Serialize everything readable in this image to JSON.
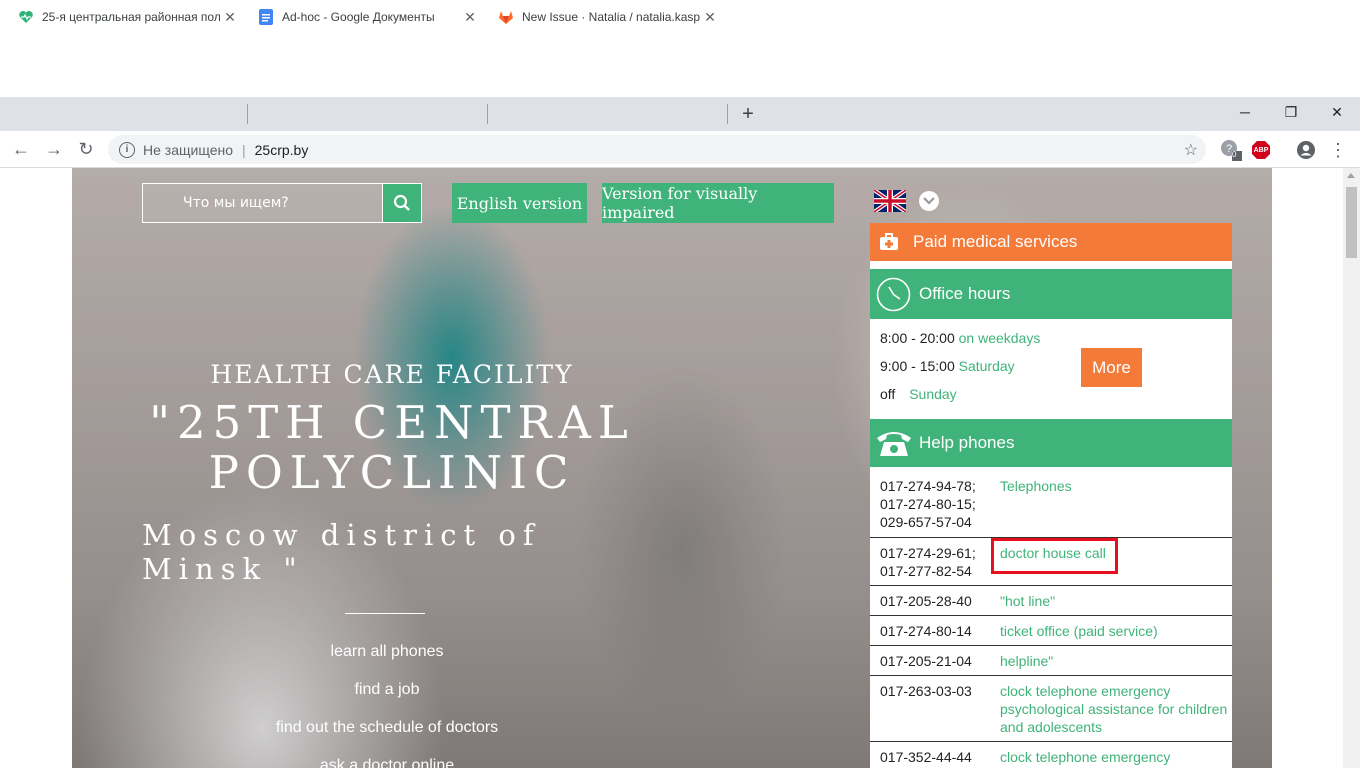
{
  "browser": {
    "tabs": [
      {
        "title": "25-я центральная районная пол",
        "close": "✕"
      },
      {
        "title": "Ad-hoc - Google Документы",
        "close": "✕"
      },
      {
        "title": "New Issue · Natalia / natalia.kasp",
        "close": "✕"
      }
    ],
    "new_tab": "+",
    "window": {
      "minimize": "─",
      "maximize": "❐",
      "close": "✕"
    },
    "nav": {
      "back": "←",
      "forward": "→",
      "reload": "↻"
    },
    "omnibox": {
      "security": "Не защищено",
      "url": "25crp.by",
      "star": "☆"
    },
    "ext_badge": "0",
    "ext_abp": "ABP",
    "menu": "⋮"
  },
  "page": {
    "search_placeholder": "Что мы ищем?",
    "english_version": "English version",
    "visually_impaired": "Version for visually impaired",
    "hero": {
      "line1": "HEALTH CARE FACILITY",
      "line2": "\"25TH CENTRAL POLYCLINIC",
      "line3": "Moscow district of Minsk \""
    },
    "links": [
      "learn all phones",
      "find a job",
      "find out the schedule of doctors",
      "ask a doctor online"
    ],
    "paid_services": "Paid medical services",
    "office_hours": {
      "title": "Office hours",
      "rows": [
        {
          "time": "8:00 - 20:00",
          "day": "on weekdays"
        },
        {
          "time": "9:00 - 15:00",
          "day": "Saturday"
        },
        {
          "time": "off",
          "day": "Sunday"
        }
      ],
      "more": "More"
    },
    "help_phones": {
      "title": "Help phones",
      "rows": [
        {
          "num": "017-274-94-78;\n017-274-80-15;\n029-657-57-04",
          "desc": "Telephones"
        },
        {
          "num": "017-274-29-61;\n017-277-82-54",
          "desc": "doctor house call"
        },
        {
          "num": "017-205-28-40",
          "desc": "\"hot line\""
        },
        {
          "num": "017-274-80-14",
          "desc": "ticket office (paid service)"
        },
        {
          "num": "017-205-21-04",
          "desc": "helpline\""
        },
        {
          "num": "017-263-03-03",
          "desc": "clock telephone emergency psychological assistance for children and adolescents"
        },
        {
          "num": "017-352-44-44",
          "desc": "clock telephone emergency"
        }
      ]
    }
  }
}
